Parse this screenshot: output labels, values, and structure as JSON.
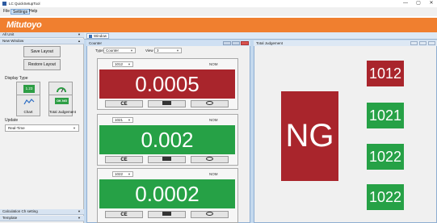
{
  "app": {
    "title": "LC QuickSetupTool"
  },
  "window_controls": {
    "minimize": "—",
    "maximize": "▢",
    "close": "✕"
  },
  "menu": {
    "items": [
      "File",
      "Settings",
      "Help"
    ]
  },
  "brand": {
    "logo_text": "Mitutoyo",
    "color": "#f07f2f"
  },
  "sidebar": {
    "header_top": "All Unit",
    "header_window": "New Window",
    "save_layout": "Save Layout",
    "restore_layout": "Restore Layout",
    "display_type_label": "Display Type",
    "display_types": [
      {
        "label": "Counter",
        "icon": "counter-icon",
        "glyph": "1.23"
      },
      {
        "label": "Meter",
        "icon": "meter-icon"
      },
      {
        "label": "Chart",
        "icon": "chart-icon"
      },
      {
        "label": "Total Judgement",
        "icon": "judgement-icon",
        "glyph": "OK NG"
      }
    ],
    "update_label": "Update",
    "update_value": "Real-Time",
    "footer_items": [
      "Calculation Ch setting",
      "Template"
    ]
  },
  "workspace": {
    "tab_label": "Window"
  },
  "counter_panel": {
    "title": "Counter",
    "type_label": "Type",
    "type_value": "Counter",
    "view_label": "View",
    "view_value": "3",
    "devices": [
      {
        "id": "1012",
        "nom": "NOM",
        "value": "0.0005",
        "status": "NG",
        "color": "#a9252c"
      },
      {
        "id": "1021",
        "nom": "NOM",
        "value": "0.002",
        "status": "OK",
        "color": "#26a146"
      },
      {
        "id": "1022",
        "nom": "NOM",
        "value": "0.0002",
        "status": "OK",
        "color": "#26a146"
      }
    ],
    "buttons": {
      "ce": "CE"
    }
  },
  "judge_panel": {
    "title": "Total Judgement",
    "result": "NG",
    "ng_color": "#a9252c",
    "ok_color": "#26a146",
    "tiles": [
      {
        "label": "1012",
        "status": "NG"
      },
      {
        "label": "1021",
        "status": "OK"
      },
      {
        "label": "1022",
        "status": "OK"
      },
      {
        "label": "1022",
        "status": "OK"
      }
    ]
  }
}
